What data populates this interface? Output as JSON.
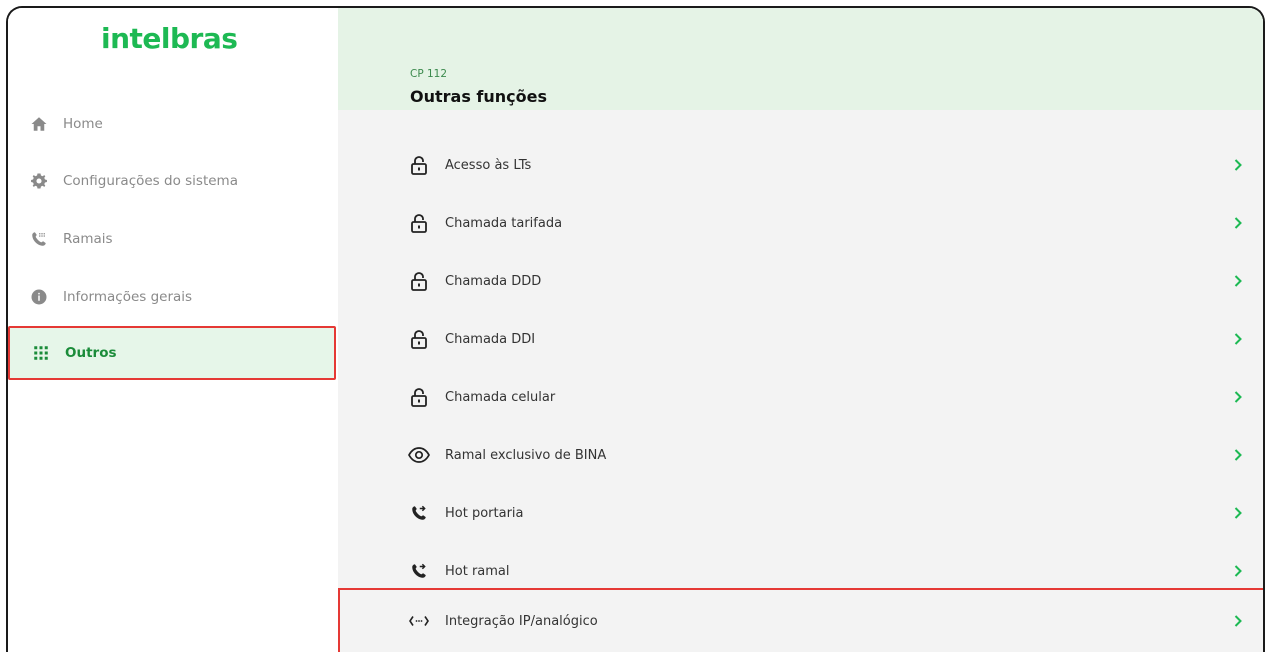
{
  "app": {
    "logo_text": "intelbras",
    "accent_color": "#1db953",
    "highlight_color": "#e53935"
  },
  "sidebar": {
    "items": [
      {
        "label": "Home",
        "icon": "home-icon"
      },
      {
        "label": "Configurações do sistema",
        "icon": "gear-icon"
      },
      {
        "label": "Ramais",
        "icon": "phone-dialpad-icon"
      },
      {
        "label": "Informações gerais",
        "icon": "info-icon"
      },
      {
        "label": "Outros",
        "icon": "grid-icon",
        "active": true
      }
    ]
  },
  "header": {
    "breadcrumb": "CP 112",
    "title": "Outras funções"
  },
  "list": {
    "items": [
      {
        "label": "Acesso às LTs",
        "icon": "lock-icon"
      },
      {
        "label": "Chamada tarifada",
        "icon": "lock-icon"
      },
      {
        "label": "Chamada DDD",
        "icon": "lock-icon"
      },
      {
        "label": "Chamada DDI",
        "icon": "lock-icon"
      },
      {
        "label": "Chamada celular",
        "icon": "lock-icon"
      },
      {
        "label": "Ramal exclusivo de BINA",
        "icon": "eye-icon"
      },
      {
        "label": "Hot portaria",
        "icon": "phone-forward-icon"
      },
      {
        "label": "Hot ramal",
        "icon": "phone-forward-icon"
      },
      {
        "label": "Integração IP/analógico",
        "icon": "code-arrows-icon",
        "highlighted": true
      }
    ]
  }
}
